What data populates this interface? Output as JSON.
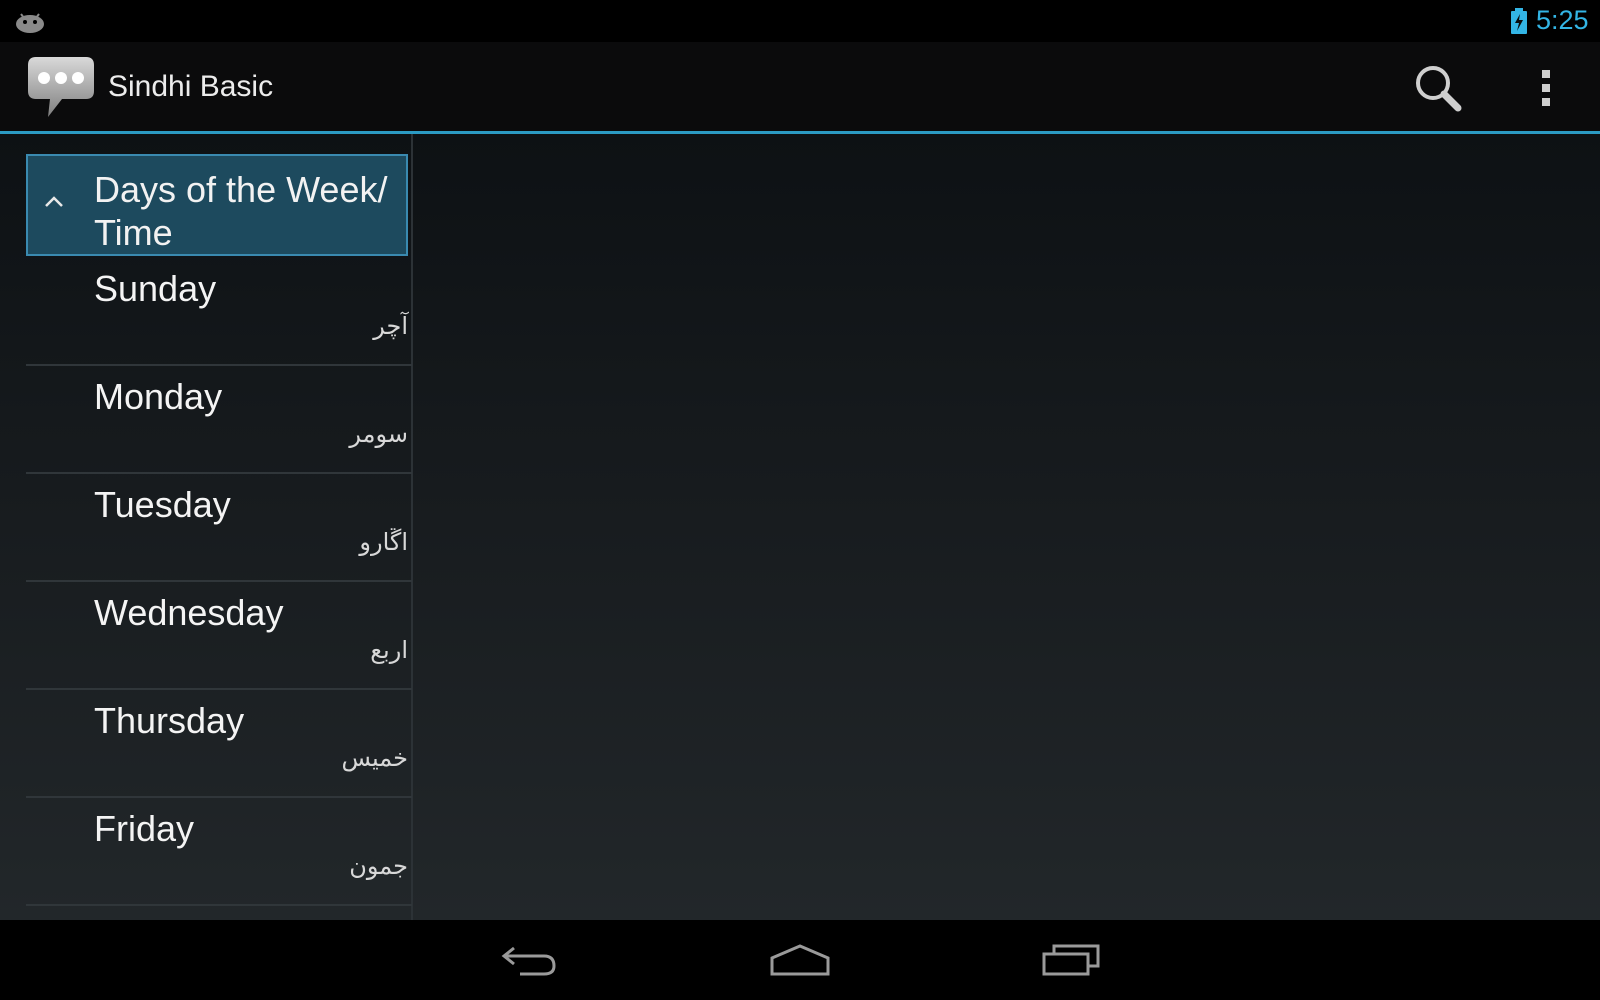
{
  "status_bar": {
    "time": "5:25",
    "icons": [
      "android-debug-icon",
      "battery-charging-icon"
    ]
  },
  "action_bar": {
    "title": "Sindhi Basic",
    "icons": [
      "speech-bubble-app-icon",
      "search-icon",
      "overflow-menu-icon"
    ]
  },
  "list": {
    "group_title": "Days of the Week/ Time",
    "items": [
      {
        "english": "Sunday",
        "sindhi": "آچر"
      },
      {
        "english": "Monday",
        "sindhi": "سومر"
      },
      {
        "english": "Tuesday",
        "sindhi": "اڱارو"
      },
      {
        "english": "Wednesday",
        "sindhi": "اربع"
      },
      {
        "english": "Thursday",
        "sindhi": "خميس"
      },
      {
        "english": "Friday",
        "sindhi": "جمون"
      }
    ]
  },
  "nav_bar": {
    "icons": [
      "back-icon",
      "home-icon",
      "recents-icon"
    ]
  },
  "colors": {
    "accent": "#33b5e5",
    "selected_header": "#1d4a5e"
  }
}
